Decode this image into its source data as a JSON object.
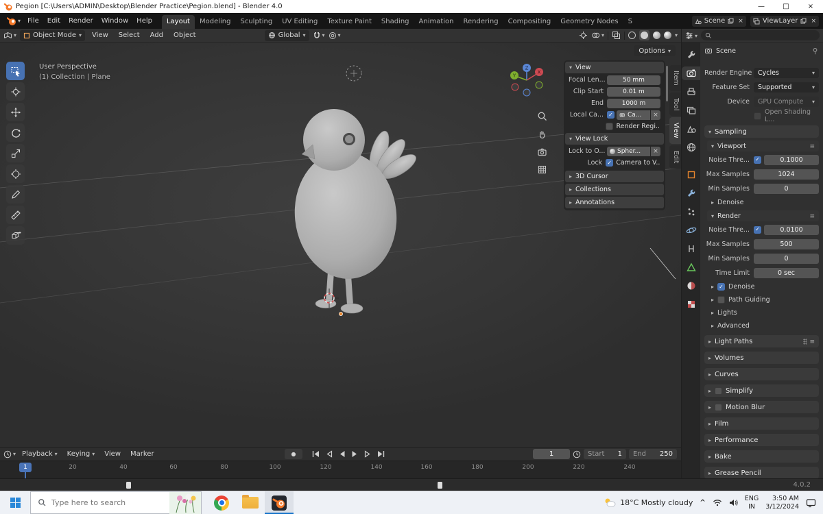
{
  "window": {
    "title": "Pegion [C:\\Users\\ADMIN\\Desktop\\Blender Practice\\Pegion.blend] - Blender 4.0"
  },
  "icons": {
    "chevron_down": "▾",
    "chevron_right": "▸",
    "close_x": "×",
    "check": "✓",
    "menu": "≡",
    "record_dot": "●",
    "caret_up": "^",
    "win_minimize": "—",
    "win_maximize": "□",
    "win_close": "×"
  },
  "topbar": {
    "menus": [
      "File",
      "Edit",
      "Render",
      "Window",
      "Help"
    ],
    "workspaces": [
      "Layout",
      "Modeling",
      "Sculpting",
      "UV Editing",
      "Texture Paint",
      "Shading",
      "Animation",
      "Rendering",
      "Compositing",
      "Geometry Nodes",
      "S"
    ],
    "scene_label": "Scene",
    "viewlayer_label": "ViewLayer"
  },
  "viewport_header": {
    "mode": "Object Mode",
    "menus": [
      "View",
      "Select",
      "Add",
      "Object"
    ],
    "orientation": "Global",
    "options_label": "Options"
  },
  "viewport": {
    "perspective_label": "User Perspective",
    "collection_label": "(1) Collection | Plane",
    "axis_labels": {
      "x": "X",
      "y": "Y",
      "z": "Z"
    }
  },
  "npanel": {
    "view_title": "View",
    "focal_label": "Focal Len...",
    "focal_value": "50 mm",
    "clip_start_label": "Clip Start",
    "clip_start_value": "0.01 m",
    "clip_end_label": "End",
    "clip_end_value": "1000 m",
    "local_camera_label": "Local Ca...",
    "local_camera_value": "Ca...",
    "render_region_label": "Render Regi...",
    "view_lock_title": "View Lock",
    "lock_to_object_label": "Lock to O...",
    "lock_to_object_value": "Spher...",
    "lock_label": "Lock",
    "lock_value": "Camera to V...",
    "collapsed": [
      "3D Cursor",
      "Collections",
      "Annotations"
    ]
  },
  "side_tabs": [
    "Item",
    "Tool",
    "View",
    "Edit"
  ],
  "properties": {
    "breadcrumb": "Scene",
    "render_engine_label": "Render Engine",
    "render_engine_value": "Cycles",
    "feature_set_label": "Feature Set",
    "feature_set_value": "Supported",
    "device_label": "Device",
    "device_value": "GPU Compute",
    "open_shading_label": "Open Shading L...",
    "sampling_title": "Sampling",
    "viewport_title": "Viewport",
    "vp_noise_label": "Noise Thre...",
    "vp_noise_value": "0.1000",
    "vp_max_label": "Max Samples",
    "vp_max_value": "1024",
    "vp_min_label": "Min Samples",
    "vp_min_value": "0",
    "vp_denoise_label": "Denoise",
    "render_title": "Render",
    "r_noise_label": "Noise Thre...",
    "r_noise_value": "0.0100",
    "r_max_label": "Max Samples",
    "r_max_value": "500",
    "r_min_label": "Min Samples",
    "r_min_value": "0",
    "r_time_label": "Time Limit",
    "r_time_value": "0 sec",
    "r_denoise_label": "Denoise",
    "path_guiding_label": "Path Guiding",
    "lights_label": "Lights",
    "advanced_label": "Advanced",
    "sections": [
      "Light Paths",
      "Volumes",
      "Curves",
      "Simplify",
      "Motion Blur",
      "Film",
      "Performance",
      "Bake",
      "Grease Pencil"
    ]
  },
  "timeline": {
    "menus": [
      "Playback",
      "Keying",
      "View",
      "Marker"
    ],
    "current_frame": "1",
    "start_label": "Start",
    "start_value": "1",
    "end_label": "End",
    "end_value": "250",
    "ticks": [
      "20",
      "40",
      "60",
      "80",
      "100",
      "120",
      "140",
      "160",
      "180",
      "200",
      "220",
      "240"
    ],
    "playhead": "1"
  },
  "statusbar": {
    "version": "4.0.2"
  },
  "taskbar": {
    "search_placeholder": "Type here to search",
    "weather": "18°C Mostly cloudy",
    "lang_primary": "ENG",
    "lang_secondary": "IN",
    "time": "3:50 AM",
    "date": "3/12/2024"
  }
}
